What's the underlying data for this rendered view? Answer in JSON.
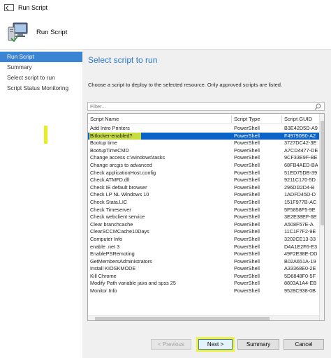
{
  "window": {
    "title": "Run Script"
  },
  "header": {
    "title": "Run Script"
  },
  "sidebar": {
    "items": [
      {
        "label": "Run Script",
        "active": true
      },
      {
        "label": "Summary",
        "active": false
      },
      {
        "label": "Select script to run",
        "active": false
      },
      {
        "label": "Script Status Monitoring",
        "active": false
      }
    ]
  },
  "main": {
    "title": "Select script to run",
    "description": "Choose a script to deploy to the selected resource. Only approved scripts are listed.",
    "filter_placeholder": "Filter...",
    "columns": [
      "Script Name",
      "Script Type",
      "Script GUID"
    ],
    "rows": [
      {
        "name": "Add Intro Printers",
        "type": "PowerShell",
        "guid": "B3E42D5D-A9"
      },
      {
        "name": "Bitlocker-enabled?",
        "type": "PowerShell",
        "guid": "F49790B0-A2",
        "selected": true
      },
      {
        "name": "Bootup time",
        "type": "PowerShell",
        "guid": "3727DC42-3E"
      },
      {
        "name": "BootupTimeCMD",
        "type": "PowerShell",
        "guid": "A7CD4477-DE"
      },
      {
        "name": "Change access c:\\windows\\tasks",
        "type": "PowerShell",
        "guid": "9CF33E9F-BE"
      },
      {
        "name": "Change arcgis to advanced",
        "type": "PowerShell",
        "guid": "68FB4AED-BA"
      },
      {
        "name": "Check applicationHost.config",
        "type": "PowerShell",
        "guid": "51ED75DB-39"
      },
      {
        "name": "Check ATMFD.dll",
        "type": "PowerShell",
        "guid": "9211C170-5D"
      },
      {
        "name": "Check IE default browser",
        "type": "PowerShell",
        "guid": "296DD2D4-B"
      },
      {
        "name": "Check LP NL Windows 10",
        "type": "PowerShell",
        "guid": "1ADFD45D-D"
      },
      {
        "name": "Check Stata.LIC",
        "type": "PowerShell",
        "guid": "151F977B-AC"
      },
      {
        "name": "Check Timeserver",
        "type": "PowerShell",
        "guid": "5F5858F5-9E"
      },
      {
        "name": "Check webclient service",
        "type": "PowerShell",
        "guid": "3E2E38EF-6E"
      },
      {
        "name": "Clear branchcache",
        "type": "PowerShell",
        "guid": "A508F57E-A"
      },
      {
        "name": "ClearSCCMCache10Days",
        "type": "PowerShell",
        "guid": "11C1F7F2-9E"
      },
      {
        "name": "Computer Info",
        "type": "PowerShell",
        "guid": "3202CE13-33"
      },
      {
        "name": "enable .net 3",
        "type": "PowerShell",
        "guid": "D4A1E2F6-E3"
      },
      {
        "name": "EnablePSRemoting",
        "type": "PowerShell",
        "guid": "49F2E38E-DD"
      },
      {
        "name": "GetMembersAdministrators",
        "type": "PowerShell",
        "guid": "B02A651A-19"
      },
      {
        "name": "Install KIOSKMODE",
        "type": "PowerShell",
        "guid": "A33368E0-2E"
      },
      {
        "name": "Kill Chrome",
        "type": "PowerShell",
        "guid": "5D6848F0-5F"
      },
      {
        "name": "Modify Path variable java and spss 25",
        "type": "PowerShell",
        "guid": "8803A1A4-EB"
      },
      {
        "name": "Monitor Info",
        "type": "PowerShell",
        "guid": "9528C938-0B"
      }
    ]
  },
  "buttons": {
    "previous": "< Previous",
    "next": "Next >",
    "summary": "Summary",
    "cancel": "Cancel"
  },
  "colors": {
    "accent": "#2b78c5",
    "selection": "#0b63c7",
    "highlight": "#e9f02a"
  }
}
